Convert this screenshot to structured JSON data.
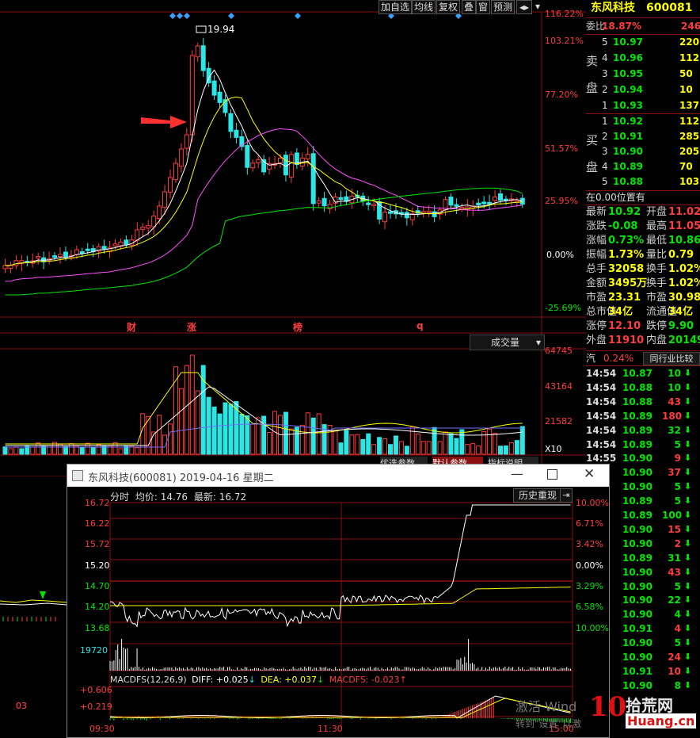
{
  "toolbar": {
    "buttons": [
      "加自选",
      "均线",
      "复权",
      "叠",
      "窗",
      "预测"
    ],
    "scroll_icon": "scroll-arrows-icon",
    "dropdown_icon": "dropdown-arrow-icon"
  },
  "main_chart": {
    "peak_label": "19.94",
    "pct_axis": [
      "116.22%",
      "103.21%",
      "77.20%",
      "51.57%",
      "25.95%",
      "0.00%",
      "-25.69%"
    ],
    "events": [
      "财",
      "涨",
      "榜",
      "q"
    ],
    "volume_dropdown": "成交量",
    "volume_axis": [
      "64745",
      "43164",
      "21582",
      "X10"
    ],
    "bottom_tabs": [
      "优选参数",
      "默认参数",
      "指标说明"
    ],
    "left_bottom_label": "03"
  },
  "stock_header": {
    "name": "东风科技",
    "code": "600081"
  },
  "order_book": {
    "weibi_label": "委比",
    "weibi_value": "18.87%",
    "weibi_diff": "246",
    "sell_label_1": "卖",
    "sell_label_2": "盘",
    "buy_label_1": "买",
    "buy_label_2": "盘",
    "asks": [
      {
        "level": "5",
        "price": "10.97",
        "vol": "220"
      },
      {
        "level": "4",
        "price": "10.96",
        "vol": "112"
      },
      {
        "level": "3",
        "price": "10.95",
        "vol": "50"
      },
      {
        "level": "2",
        "price": "10.94",
        "vol": "10"
      },
      {
        "level": "1",
        "price": "10.93",
        "vol": "137"
      }
    ],
    "bids": [
      {
        "level": "1",
        "price": "10.92",
        "vol": "112"
      },
      {
        "level": "2",
        "price": "10.91",
        "vol": "285"
      },
      {
        "level": "3",
        "price": "10.90",
        "vol": "205"
      },
      {
        "level": "4",
        "price": "10.89",
        "vol": "70"
      },
      {
        "level": "5",
        "price": "10.88",
        "vol": "103"
      }
    ],
    "position_note": "在0.00位置有"
  },
  "quote": [
    {
      "l1": "最新",
      "v1": "10.92",
      "l2": "开盘",
      "v2": "11.02"
    },
    {
      "l1": "涨跌",
      "v1": "-0.08",
      "l2": "最高",
      "v2": "11.05"
    },
    {
      "l1": "涨幅",
      "v1": "0.73%",
      "l2": "最低",
      "v2": "10.86"
    },
    {
      "l1": "振幅",
      "v1": "1.73%",
      "l2": "量比",
      "v2": "0.79"
    },
    {
      "l1": "总手",
      "v1": "32058",
      "l2": "换手",
      "v2": "1.02%"
    },
    {
      "l1": "金额",
      "v1": "3495万",
      "l2": "换手",
      "v2": "1.02%"
    },
    {
      "l1": "市盈",
      "v1": "23.31",
      "l2": "市盈",
      "v2": "30.98"
    },
    {
      "l1": "总市值",
      "v1": "34亿",
      "l2": "流通值",
      "v2": "34亿"
    },
    {
      "l1": "涨停",
      "v1": "12.10",
      "l2": "跌停",
      "v2": "9.90"
    },
    {
      "l1": "外盘",
      "v1": "11910",
      "l2": "内盘",
      "v2": "20149"
    }
  ],
  "industry": {
    "prefix": "汽",
    "change": "0.24%",
    "button": "同行业比较"
  },
  "ticks": [
    {
      "time": "14:54",
      "price": "10.87",
      "vol": "10",
      "dir": "down"
    },
    {
      "time": "14:54",
      "price": "10.88",
      "vol": "10",
      "dir": "down"
    },
    {
      "time": "14:54",
      "price": "10.88",
      "vol": "43",
      "dir": "down"
    },
    {
      "time": "14:54",
      "price": "10.89",
      "vol": "180",
      "dir": "down"
    },
    {
      "time": "14:54",
      "price": "10.89",
      "vol": "32",
      "dir": "down"
    },
    {
      "time": "14:54",
      "price": "10.89",
      "vol": "5",
      "dir": "down"
    },
    {
      "time": "14:55",
      "price": "10.90",
      "vol": "9",
      "dir": "down"
    },
    {
      "time": "",
      "price": "10.90",
      "vol": "37",
      "dir": "down"
    },
    {
      "time": "",
      "price": "10.90",
      "vol": "5",
      "dir": "down"
    },
    {
      "time": "",
      "price": "10.89",
      "vol": "5",
      "dir": "down"
    },
    {
      "time": "",
      "price": "10.89",
      "vol": "100",
      "dir": "down"
    },
    {
      "time": "",
      "price": "10.90",
      "vol": "15",
      "dir": "down"
    },
    {
      "time": "",
      "price": "10.90",
      "vol": "2",
      "dir": "down"
    },
    {
      "time": "",
      "price": "10.89",
      "vol": "31",
      "dir": "down"
    },
    {
      "time": "",
      "price": "10.90",
      "vol": "43",
      "dir": "down"
    },
    {
      "time": "",
      "price": "10.90",
      "vol": "5",
      "dir": "down"
    },
    {
      "time": "",
      "price": "10.90",
      "vol": "22",
      "dir": "down"
    },
    {
      "time": "",
      "price": "10.90",
      "vol": "4",
      "dir": "down"
    },
    {
      "time": "",
      "price": "10.91",
      "vol": "4",
      "dir": "down"
    },
    {
      "time": "",
      "price": "10.90",
      "vol": "5",
      "dir": "down"
    },
    {
      "time": "",
      "price": "10.90",
      "vol": "24",
      "dir": "down"
    },
    {
      "time": "",
      "price": "10.91",
      "vol": "10",
      "dir": "down"
    },
    {
      "time": "",
      "price": "10.90",
      "vol": "8",
      "dir": "down"
    }
  ],
  "popup": {
    "title": "东风科技(600081) 2019-04-16 星期二",
    "header_label": "分时",
    "avg_label": "均价: 14.76",
    "latest_label": "最新: 16.72",
    "history_button": "历史重现",
    "price_axis": [
      "16.72",
      "16.22",
      "15.72",
      "15.20",
      "14.70",
      "14.20",
      "13.68"
    ],
    "pct_axis": [
      "10.00%",
      "6.71%",
      "3.42%",
      "0.00%",
      "3.29%",
      "6.58%",
      "10.00%"
    ],
    "volume_label": "19720",
    "macd_params": "MACDFS(12,26,9)",
    "diff_label": "DIFF: +0.025",
    "dea_label": "DEA: +0.037",
    "macdfs_label": "MACDFS: -0.023",
    "macd_axis": [
      "+0.606",
      "+0.219"
    ],
    "time_axis": [
      "09:30",
      "11:30",
      "15:00"
    ],
    "overlay_text_1": "激活 Wind",
    "overlay_text_2": "转到\"设置\"以激",
    "watermark_main": "拾荒网",
    "watermark_url": "Huang.cn",
    "watermark_number": "10"
  }
}
